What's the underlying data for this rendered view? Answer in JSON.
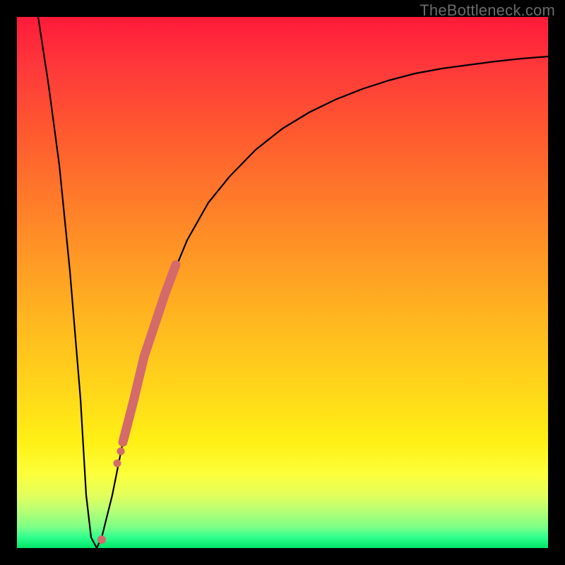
{
  "watermark": {
    "text": "TheBottleneck.com"
  },
  "chart_data": {
    "type": "line",
    "title": "",
    "xlabel": "",
    "ylabel": "",
    "xlim": [
      0,
      100
    ],
    "ylim": [
      0,
      100
    ],
    "grid": false,
    "legend": false,
    "series": [
      {
        "name": "bottleneck-curve",
        "x": [
          4,
          6,
          8,
          10,
          12,
          13,
          14,
          15,
          16,
          18,
          20,
          24,
          28,
          32,
          36,
          40,
          45,
          50,
          55,
          60,
          65,
          70,
          75,
          80,
          85,
          90,
          95,
          100
        ],
        "y": [
          100,
          87,
          72,
          52,
          28,
          10,
          2,
          0,
          2,
          10,
          20,
          36,
          48,
          58,
          65,
          70,
          75,
          79,
          82,
          84.5,
          86.5,
          88,
          89.3,
          90.3,
          91,
          91.6,
          92.1,
          92.5
        ]
      }
    ],
    "annotations": [
      {
        "name": "curve-marker-thick",
        "x_range": [
          20,
          30
        ],
        "style": "thick-salmon"
      },
      {
        "name": "curve-marker-dot-1",
        "x": 17.5,
        "style": "salmon-dot"
      },
      {
        "name": "curve-marker-dot-2",
        "x": 18.5,
        "style": "salmon-dot"
      },
      {
        "name": "curve-marker-dot-3",
        "x": 15,
        "style": "salmon-dot"
      }
    ],
    "colors": {
      "curve": "#000000",
      "marker": "#d46a6a",
      "background_top": "#ff1a3a",
      "background_bottom": "#00e566"
    }
  }
}
